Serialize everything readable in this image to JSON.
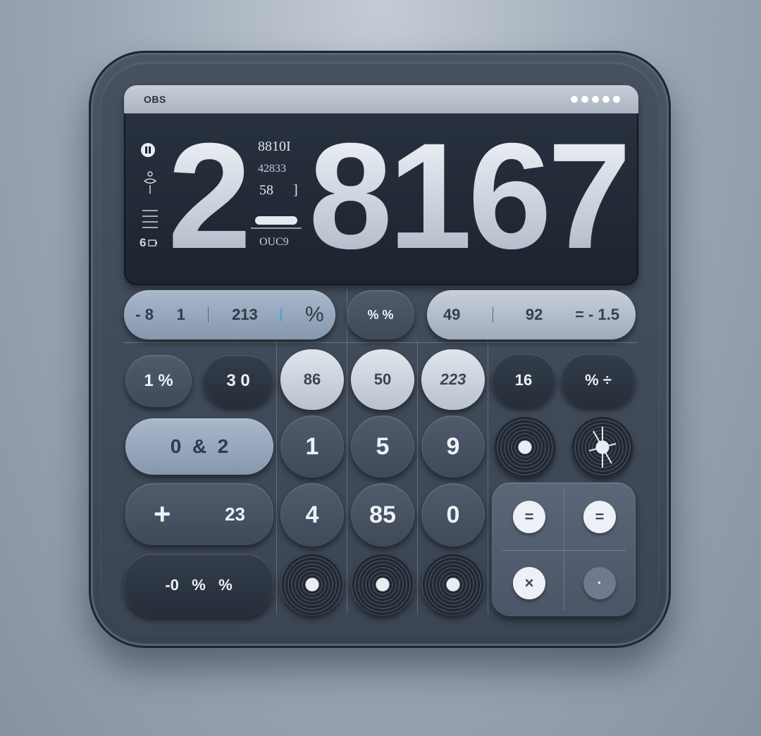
{
  "screen": {
    "brand": "OBS",
    "display": {
      "part1": "2",
      "part2": "8167"
    },
    "side_icons": [
      "pause-icon",
      "figure-icon",
      "menu-icon",
      "battery-icon"
    ],
    "side_label": "6",
    "mini_readouts": [
      "8810I",
      "42833",
      "58",
      "]",
      "OUC9"
    ]
  },
  "function_row": {
    "left_pill": {
      "a": "- 8",
      "b": "1",
      "c": "213",
      "d": "%"
    },
    "mid_key": "% %",
    "right_pill": {
      "a": "49",
      "b": "92",
      "c": "= - 1.5"
    }
  },
  "keys_row1": [
    "1 %",
    "3 0",
    "86",
    "50",
    "223",
    "16",
    "% ÷"
  ],
  "keys_row2": {
    "wide": "0  &  2",
    "digits": [
      "1",
      "5",
      "9"
    ]
  },
  "keys_row3": {
    "wide_left": "+",
    "wide_right": "23",
    "digits": [
      "4",
      "85",
      "0"
    ]
  },
  "keys_row4": {
    "wide": "-0   %   %"
  },
  "eq_panel": {
    "tl": "=",
    "tr": "=",
    "bl": "×",
    "br": "·"
  },
  "colors": {
    "device": "#3b4553",
    "screen": "#1d2430",
    "accent": "#a9b8cb"
  }
}
